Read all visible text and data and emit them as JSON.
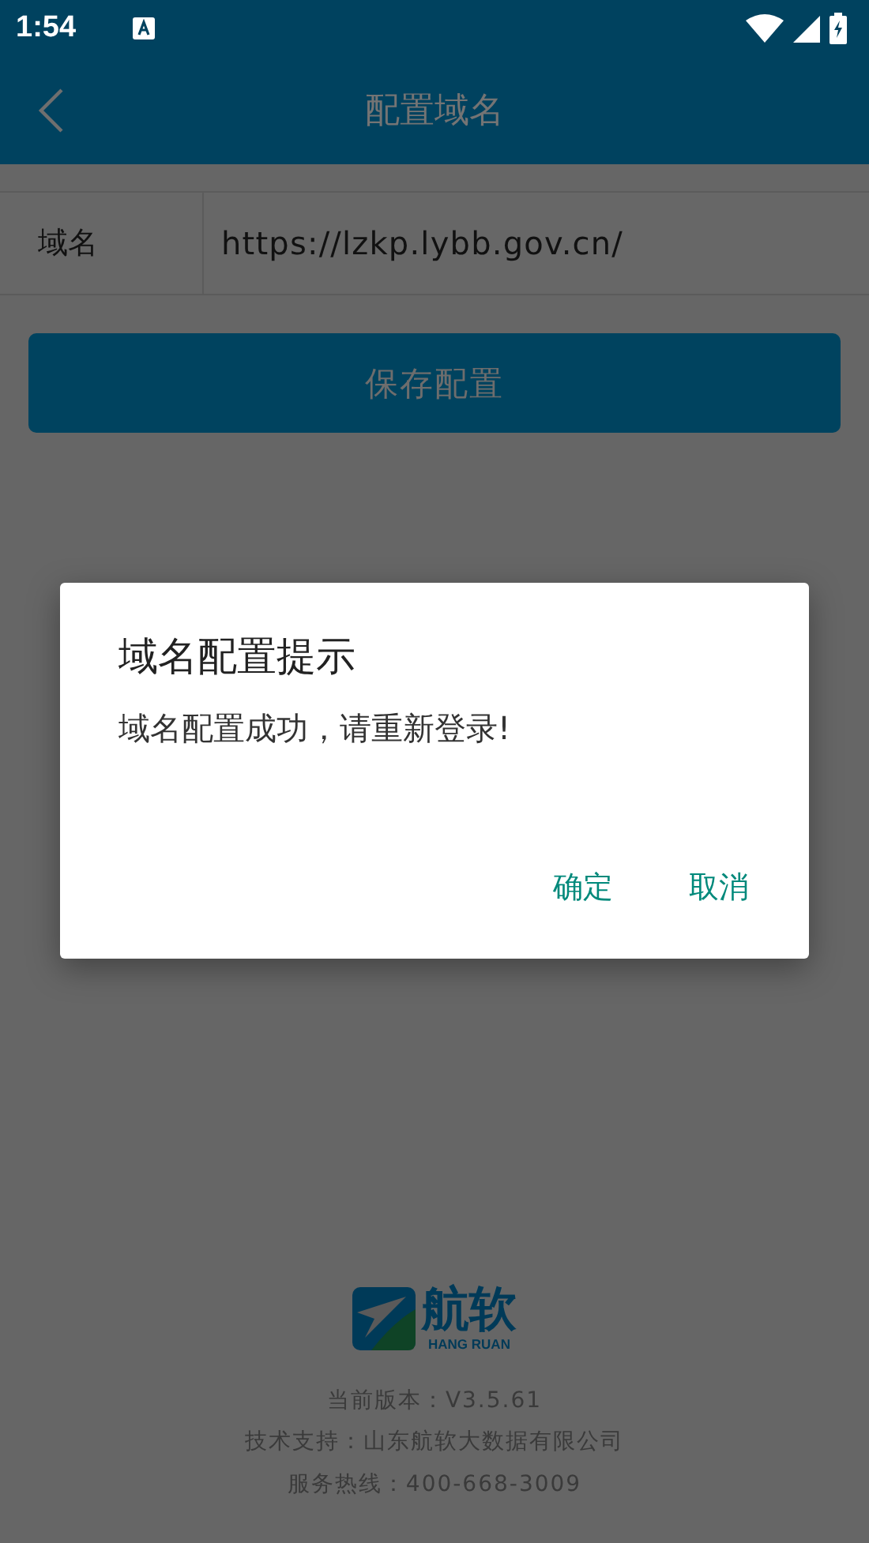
{
  "status_bar": {
    "time": "1:54"
  },
  "app_bar": {
    "title": "配置域名"
  },
  "form": {
    "label": "域名",
    "value": "https://lzkp.lybb.gov.cn/"
  },
  "save_button": "保存配置",
  "dialog": {
    "title": "域名配置提示",
    "message": "域名配置成功，请重新登录!",
    "buttons": [
      "确定",
      "取消"
    ]
  },
  "footer": {
    "logo_text": "航软",
    "logo_subtext": "HANG RUAN",
    "lines": [
      "当前版本：V3.5.61",
      "技术支持：山东航软大数据有限公司",
      "服务热线：400-668-3009"
    ]
  }
}
